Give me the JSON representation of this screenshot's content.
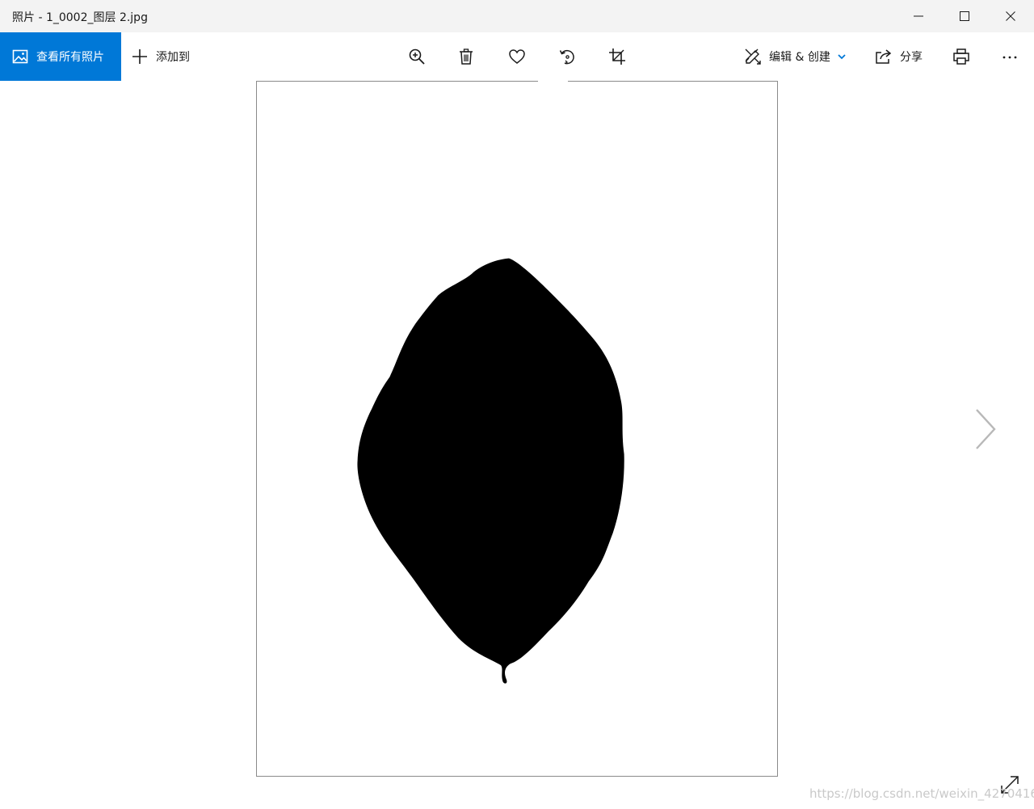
{
  "window": {
    "title": "照片 - 1_0002_图层 2.jpg"
  },
  "toolbar": {
    "view_all_label": "查看所有照片",
    "add_to_label": "添加到",
    "edit_create_label": "编辑 & 创建",
    "share_label": "分享"
  },
  "icons": {
    "view_all": "picture-icon",
    "add_to": "plus-icon",
    "zoom": "zoom-in-icon",
    "delete": "trash-icon",
    "favorite": "heart-icon",
    "rotate": "rotate-icon",
    "crop": "crop-icon",
    "edit": "edit-create-icon",
    "share": "share-icon",
    "print": "print-icon",
    "more": "more-icon",
    "next": "chevron-right-icon",
    "fullscreen": "fullscreen-icon"
  },
  "colors": {
    "accent": "#0078d7",
    "titlebar_bg": "#f3f3f3",
    "leaf": "#000000"
  },
  "watermark": "https://blog.csdn.net/weixin_42704161"
}
